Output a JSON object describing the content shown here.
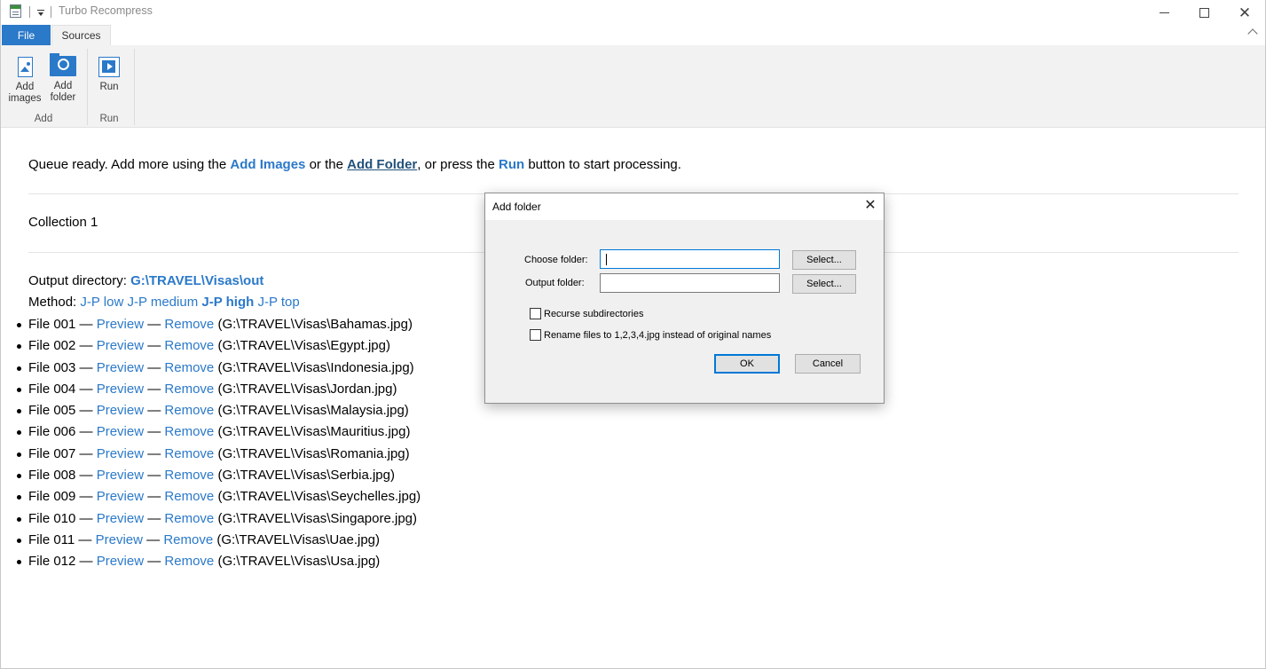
{
  "app": {
    "title": "Turbo Recompress",
    "window_controls": {
      "minimize": "minimize-icon",
      "maximize": "maximize-icon",
      "close": "close-icon"
    }
  },
  "ribbon": {
    "tabs": [
      {
        "label": "File",
        "active": false,
        "accent": "#2b79c9"
      },
      {
        "label": "Sources",
        "active": true
      }
    ],
    "groups": [
      {
        "label": "Add",
        "buttons": [
          {
            "line1": "Add",
            "line2": "images",
            "icon": "add-image-icon"
          },
          {
            "line1": "Add",
            "line2": "folder",
            "icon": "add-folder-icon"
          }
        ]
      },
      {
        "label": "Run",
        "buttons": [
          {
            "line1": "Run",
            "line2": "",
            "icon": "run-icon"
          }
        ]
      }
    ]
  },
  "main": {
    "status": {
      "part1": "Queue ready. Add more using the ",
      "link_add_images": "Add Images",
      "part2": " or the ",
      "link_add_folder": "Add Folder",
      "part3": ", or press the ",
      "link_run": "Run",
      "part4": " button to start processing."
    },
    "collection_title": "Collection 1",
    "output_directory": {
      "label": "Output directory: ",
      "value": "G:\\TRAVEL\\Visas\\out"
    },
    "method": {
      "label": "Method: ",
      "options": [
        {
          "label": "J-P low",
          "selected": false
        },
        {
          "label": "J-P medium",
          "selected": false
        },
        {
          "label": "J-P high",
          "selected": true
        },
        {
          "label": "J-P top",
          "selected": false
        }
      ]
    },
    "file_list": {
      "separator": " — ",
      "preview_label": "Preview",
      "remove_label": "Remove",
      "files": [
        {
          "name": "File 001",
          "path": "(G:\\TRAVEL\\Visas\\Bahamas.jpg)"
        },
        {
          "name": "File 002",
          "path": "(G:\\TRAVEL\\Visas\\Egypt.jpg)"
        },
        {
          "name": "File 003",
          "path": "(G:\\TRAVEL\\Visas\\Indonesia.jpg)"
        },
        {
          "name": "File 004",
          "path": "(G:\\TRAVEL\\Visas\\Jordan.jpg)"
        },
        {
          "name": "File 005",
          "path": "(G:\\TRAVEL\\Visas\\Malaysia.jpg)"
        },
        {
          "name": "File 006",
          "path": "(G:\\TRAVEL\\Visas\\Mauritius.jpg)"
        },
        {
          "name": "File 007",
          "path": "(G:\\TRAVEL\\Visas\\Romania.jpg)"
        },
        {
          "name": "File 008",
          "path": "(G:\\TRAVEL\\Visas\\Serbia.jpg)"
        },
        {
          "name": "File 009",
          "path": "(G:\\TRAVEL\\Visas\\Seychelles.jpg)"
        },
        {
          "name": "File 010",
          "path": "(G:\\TRAVEL\\Visas\\Singapore.jpg)"
        },
        {
          "name": "File 011",
          "path": "(G:\\TRAVEL\\Visas\\Uae.jpg)"
        },
        {
          "name": "File 012",
          "path": "(G:\\TRAVEL\\Visas\\Usa.jpg)"
        }
      ]
    }
  },
  "dialog": {
    "title": "Add folder",
    "choose_folder_label": "Choose folder:",
    "choose_folder_value": "",
    "output_folder_label": "Output folder:",
    "output_folder_value": "",
    "select_label": "Select...",
    "recurse_label": "Recurse subdirectories",
    "recurse_checked": false,
    "rename_label": "Rename files to 1,2,3,4.jpg instead of original names",
    "rename_checked": false,
    "ok_label": "OK",
    "cancel_label": "Cancel"
  },
  "colors": {
    "accent": "#2b79c9",
    "link_dark": "#23527c",
    "ribbon_bg": "#f2f2f2",
    "dialog_bg": "#f0f0f0",
    "focus": "#0078d7"
  }
}
